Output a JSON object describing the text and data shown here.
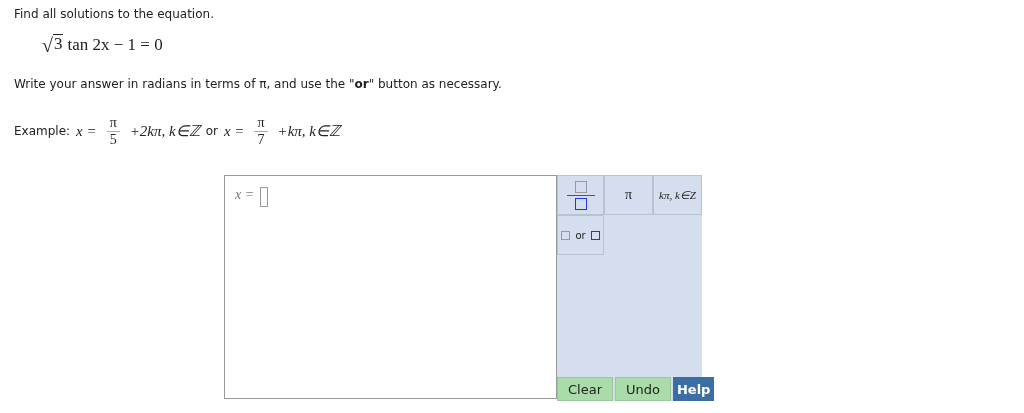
{
  "prompt": "Find all solutions to the equation.",
  "equation": {
    "radical_sign": "√",
    "radicand": "3",
    "rest": "tan 2x − 1 = 0"
  },
  "instruction": "Write your answer in radians in terms of π, and use the \"**or**\" button as necessary.",
  "example": {
    "label": "Example:",
    "separator": "or",
    "answers": [
      {
        "lhs": "x =",
        "numerator": "π",
        "denominator": "5",
        "rest": "+2kπ, k∈ℤ"
      },
      {
        "lhs": "x =",
        "numerator": "π",
        "denominator": "7",
        "rest": "+kπ, k∈ℤ"
      }
    ]
  },
  "answer_field": {
    "label": "x ="
  },
  "palette": [
    {
      "kind": "fraction"
    },
    {
      "kind": "symbol",
      "label": "π"
    },
    {
      "kind": "symbol",
      "label": "kπ, k∈Z"
    },
    {
      "kind": "or",
      "label": "or"
    }
  ],
  "actions": [
    {
      "kind": "plain",
      "label": "Clear"
    },
    {
      "kind": "plain",
      "label": "Undo"
    },
    {
      "kind": "help",
      "label": "Help"
    }
  ]
}
